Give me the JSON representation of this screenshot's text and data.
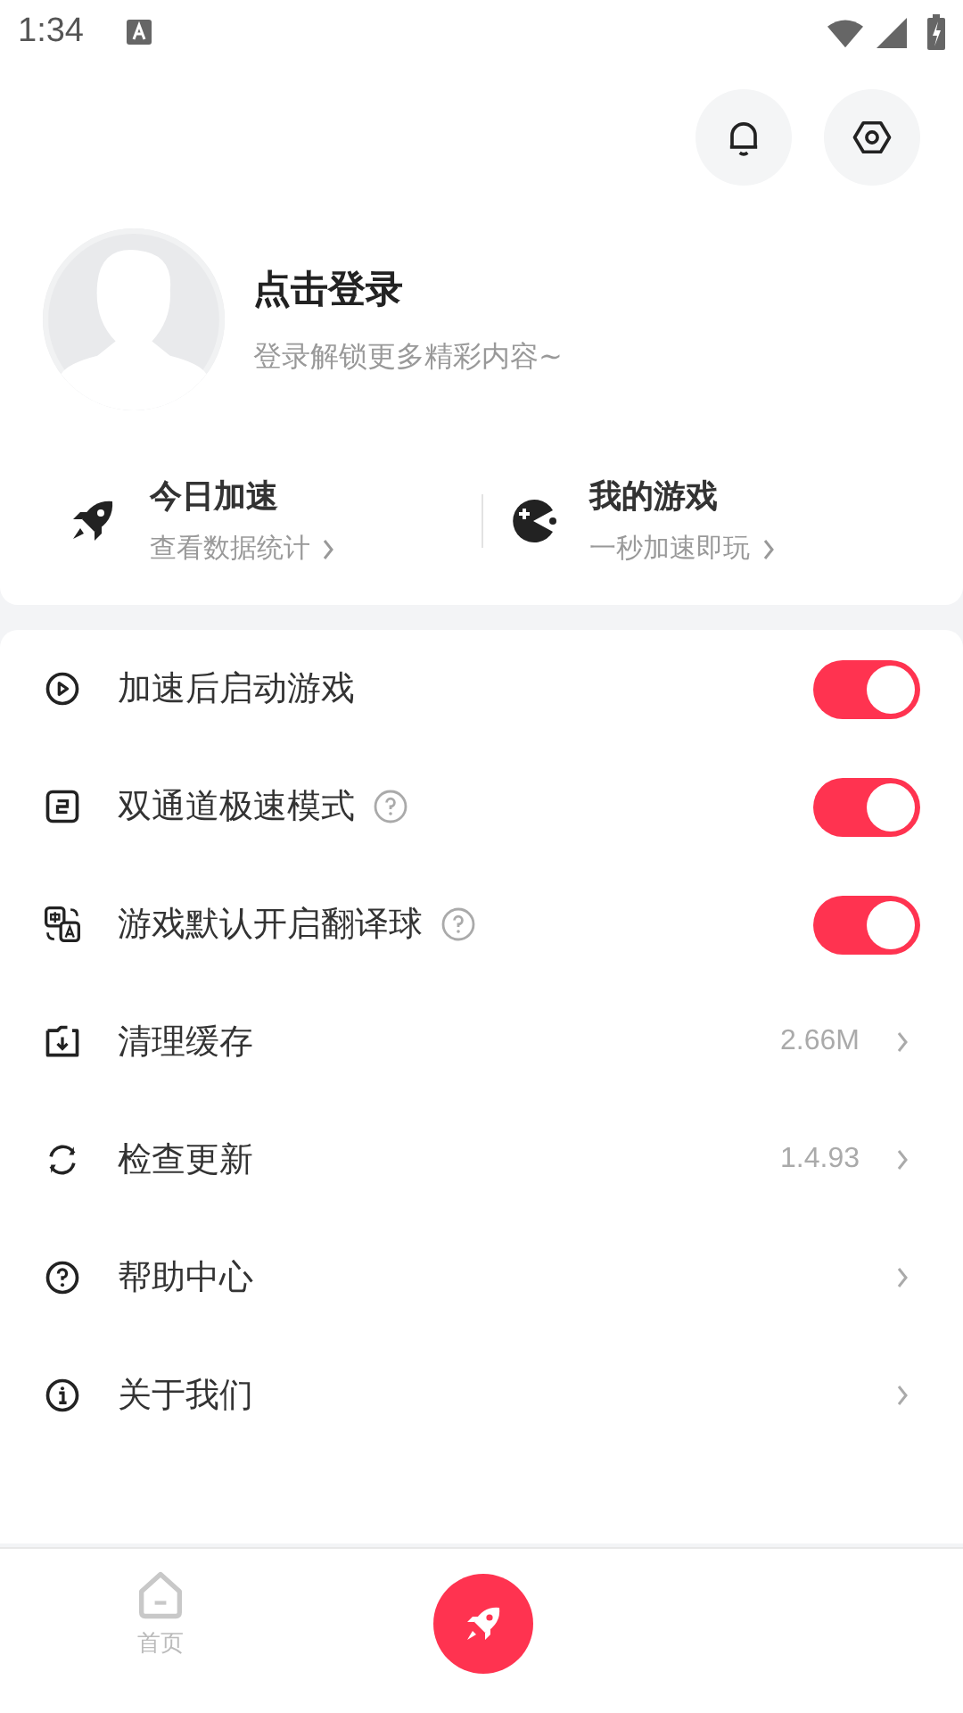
{
  "status_bar": {
    "time": "1:34"
  },
  "profile": {
    "title": "点击登录",
    "subtitle": "登录解锁更多精彩内容~"
  },
  "shortcuts": [
    {
      "kind": "rocket",
      "title": "今日加速",
      "subtitle": "查看数据统计"
    },
    {
      "kind": "gamepad",
      "title": "我的游戏",
      "subtitle": "一秒加速即玩"
    }
  ],
  "settings": [
    {
      "kind": "toggle",
      "label": "加速后启动游戏",
      "help": false,
      "on": true
    },
    {
      "kind": "toggle",
      "label": "双通道极速模式",
      "help": true,
      "on": true
    },
    {
      "kind": "toggle",
      "label": "游戏默认开启翻译球",
      "help": true,
      "on": true
    },
    {
      "kind": "link",
      "label": "清理缓存",
      "value": "2.66M"
    },
    {
      "kind": "link",
      "label": "检查更新",
      "value": "1.4.93"
    },
    {
      "kind": "link",
      "label": "帮助中心"
    },
    {
      "kind": "link",
      "label": "关于我们"
    }
  ],
  "bottom_nav": [
    {
      "kind": "home",
      "label": "首页",
      "selected": false
    },
    {
      "kind": "boost",
      "selected": false
    }
  ]
}
